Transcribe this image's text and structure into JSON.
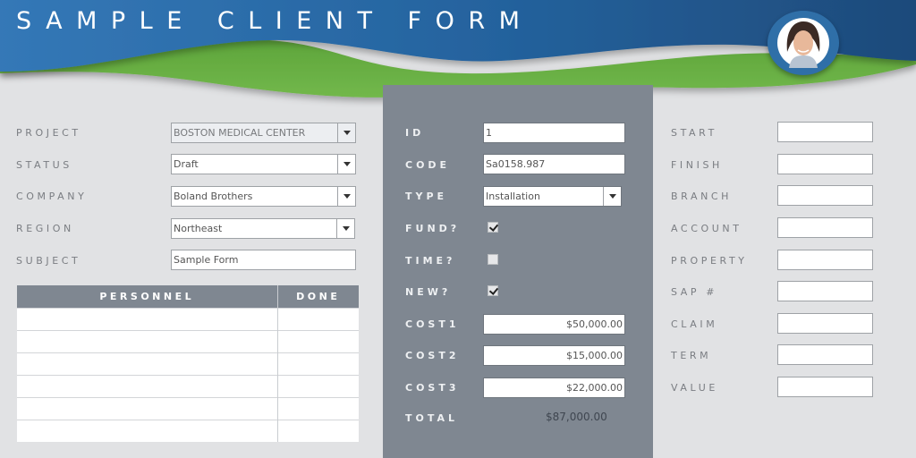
{
  "header": {
    "title": "SAMPLE CLIENT FORM",
    "avatar_icon": "user-avatar-icon"
  },
  "colors": {
    "header_blue": "#2e6fae",
    "header_dark_blue": "#1f4c7c",
    "wave_green": "#6ab344",
    "panel_gray": "#7f8791",
    "background": "#e1e2e4"
  },
  "left": {
    "fields": [
      {
        "label": "PROJECT",
        "value": "BOSTON MEDICAL CENTER",
        "type": "select",
        "readonly": true
      },
      {
        "label": "STATUS",
        "value": "Draft",
        "type": "select"
      },
      {
        "label": "COMPANY",
        "value": "Boland Brothers",
        "type": "select"
      },
      {
        "label": "REGION",
        "value": "Northeast",
        "type": "select"
      },
      {
        "label": "SUBJECT",
        "value": "Sample Form",
        "type": "text"
      }
    ],
    "table": {
      "headers": [
        "PERSONNEL",
        "DONE"
      ],
      "rows": [
        [
          "",
          ""
        ],
        [
          "",
          ""
        ],
        [
          "",
          ""
        ],
        [
          "",
          ""
        ],
        [
          "",
          ""
        ],
        [
          "",
          ""
        ]
      ]
    }
  },
  "middle": {
    "id": {
      "label": "ID",
      "value": "1"
    },
    "code": {
      "label": "CODE",
      "value": "Sa0158.987"
    },
    "type": {
      "label": "TYPE",
      "value": "Installation"
    },
    "fund": {
      "label": "FUND?",
      "checked": true
    },
    "time": {
      "label": "TIME?",
      "checked": false
    },
    "new": {
      "label": "NEW?",
      "checked": true
    },
    "cost1": {
      "label": "COST1",
      "value": "$50,000.00"
    },
    "cost2": {
      "label": "COST2",
      "value": "$15,000.00"
    },
    "cost3": {
      "label": "COST3",
      "value": "$22,000.00"
    },
    "total": {
      "label": "TOTAL",
      "value": "$87,000.00"
    }
  },
  "right": {
    "fields": [
      {
        "label": "START",
        "value": ""
      },
      {
        "label": "FINISH",
        "value": ""
      },
      {
        "label": "BRANCH",
        "value": ""
      },
      {
        "label": "ACCOUNT",
        "value": ""
      },
      {
        "label": "PROPERTY",
        "value": ""
      },
      {
        "label": "SAP #",
        "value": ""
      },
      {
        "label": "CLAIM",
        "value": ""
      },
      {
        "label": "TERM",
        "value": ""
      },
      {
        "label": "VALUE",
        "value": ""
      }
    ]
  }
}
